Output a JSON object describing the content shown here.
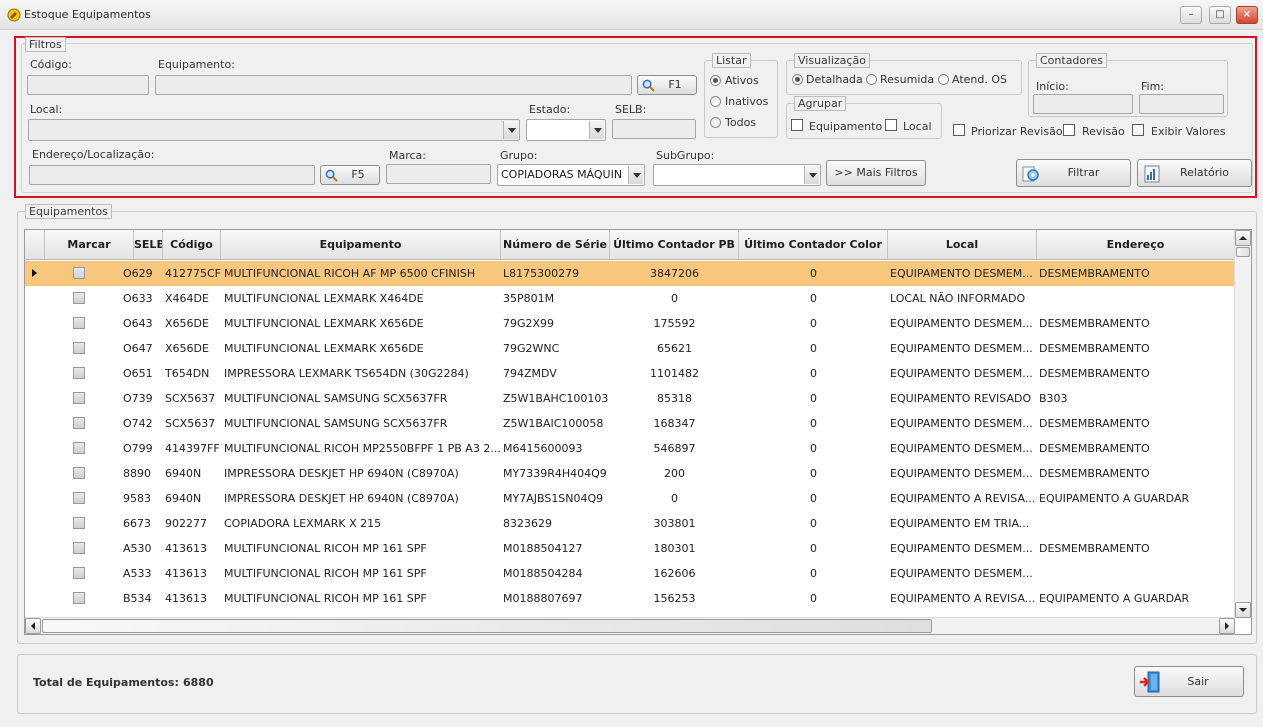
{
  "window": {
    "title": "Estoque Equipamentos",
    "minimize": "–",
    "maximize": "□",
    "close": "×"
  },
  "filters": {
    "legend": "Filtros",
    "codigo_label": "Código:",
    "equipamento_label": "Equipamento:",
    "f1_label": "F1",
    "local_label": "Local:",
    "estado_label": "Estado:",
    "selb_label": "SELB:",
    "endereco_label": "Endereço/Localização:",
    "f5_label": "F5",
    "marca_label": "Marca:",
    "grupo_label": "Grupo:",
    "grupo_value": "COPIADORAS MÁQUIN",
    "subgrupo_label": "SubGrupo:",
    "mais_filtros": ">> Mais Filtros",
    "listar": {
      "legend": "Listar",
      "ativos": "Ativos",
      "inativos": "Inativos",
      "todos": "Todos"
    },
    "visualizacao": {
      "legend": "Visualização",
      "detalhada": "Detalhada",
      "resumida": "Resumida",
      "atend": "Atend. OS"
    },
    "agrupar": {
      "legend": "Agrupar",
      "equipamento": "Equipamento",
      "local": "Local"
    },
    "contadores": {
      "legend": "Contadores",
      "inicio": "Início:",
      "fim": "Fim:"
    },
    "priorizar_revisao": "Priorizar Revisão",
    "revisao": "Revisão",
    "exibir_valores": "Exibir Valores",
    "filtrar": "Filtrar",
    "relatorio": "Relatório"
  },
  "equipamentos": {
    "legend": "Equipamentos",
    "columns": [
      "Marcar",
      "SELB",
      "Código",
      "Equipamento",
      "Número de Série",
      "Último Contador PB",
      "Último Contador Color",
      "Local",
      "Endereço"
    ],
    "rows": [
      [
        "O629",
        "412775CF",
        "MULTIFUNCIONAL RICOH AF MP 6500 CFINISH",
        "L8175300279",
        "3847206",
        "0",
        "EQUIPAMENTO  DESMEM...",
        "DESMEMBRAMENTO"
      ],
      [
        "O633",
        "X464DE",
        "MULTIFUNCIONAL LEXMARK X464DE",
        "35P801M",
        "0",
        "0",
        "LOCAL NÃO INFORMADO",
        ""
      ],
      [
        "O643",
        "X656DE",
        "MULTIFUNCIONAL LEXMARK X656DE",
        "79G2X99",
        "175592",
        "0",
        "EQUIPAMENTO  DESMEM...",
        "DESMEMBRAMENTO"
      ],
      [
        "O647",
        "X656DE",
        "MULTIFUNCIONAL LEXMARK X656DE",
        "79G2WNC",
        "65621",
        "0",
        "EQUIPAMENTO  DESMEM...",
        "DESMEMBRAMENTO"
      ],
      [
        "O651",
        "T654DN",
        "IMPRESSORA LEXMARK TS654DN (30G2284)",
        "794ZMDV",
        "1101482",
        "0",
        "EQUIPAMENTO  DESMEM...",
        "DESMEMBRAMENTO"
      ],
      [
        "O739",
        "SCX5637",
        "MULTIFUNCIONAL SAMSUNG SCX5637FR",
        "Z5W1BAHC100103",
        "85318",
        "0",
        "EQUIPAMENTO REVISADO",
        "B303"
      ],
      [
        "O742",
        "SCX5637",
        "MULTIFUNCIONAL SAMSUNG SCX5637FR",
        "Z5W1BAIC100058",
        "168347",
        "0",
        "EQUIPAMENTO  DESMEM...",
        "DESMEMBRAMENTO"
      ],
      [
        "O799",
        "414397FF",
        "MULTIFUNCIONAL RICOH MP2550BFPF 1 PB A3 2...",
        "M6415600093",
        "546897",
        "0",
        "EQUIPAMENTO  DESMEM...",
        "DESMEMBRAMENTO"
      ],
      [
        "8890",
        "6940N",
        "IMPRESSORA DESKJET HP 6940N (C8970A)",
        "MY7339R4H404Q9",
        "200",
        "0",
        "EQUIPAMENTO  DESMEM...",
        "DESMEMBRAMENTO"
      ],
      [
        "9583",
        "6940N",
        "IMPRESSORA DESKJET HP 6940N (C8970A)",
        "MY7AJBS1SN04Q9",
        "0",
        "0",
        "EQUIPAMENTO  A  REVISA...",
        "EQUIPAMENTO A GUARDAR"
      ],
      [
        "6673",
        "902277",
        "COPIADORA LEXMARK X 215",
        "8323629",
        "303801",
        "0",
        "EQUIPAMENTO  EM  TRIA...",
        ""
      ],
      [
        "A530",
        "413613",
        "MULTIFUNCIONAL RICOH MP 161 SPF",
        "M0188504127",
        "180301",
        "0",
        "EQUIPAMENTO  DESMEM...",
        "DESMEMBRAMENTO"
      ],
      [
        "A533",
        "413613",
        "MULTIFUNCIONAL RICOH MP 161 SPF",
        "M0188504284",
        "162606",
        "0",
        "EQUIPAMENTO  DESMEM...",
        ""
      ],
      [
        "B534",
        "413613",
        "MULTIFUNCIONAL RICOH MP 161 SPF",
        "M0188807697",
        "156253",
        "0",
        "EQUIPAMENTO  A  REVISA...",
        "EQUIPAMENTO A GUARDAR"
      ]
    ]
  },
  "footer": {
    "total_label": "Total de Equipamentos:",
    "total_value": "6880",
    "sair": "Sair"
  }
}
